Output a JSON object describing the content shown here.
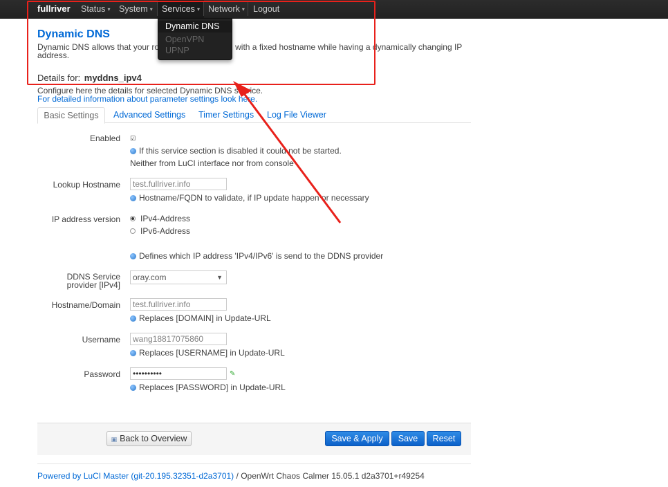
{
  "navbar": {
    "brand": "fullriver",
    "menu": [
      "Status",
      "System",
      "Services",
      "Network",
      "Logout"
    ]
  },
  "dropdown": {
    "items": [
      "Dynamic DNS",
      "OpenVPN",
      "UPNP"
    ]
  },
  "page": {
    "title": "Dynamic DNS",
    "description": "Dynamic DNS allows that your router can be reached with a fixed hostname while having a dynamically changing IP address.",
    "details_label": "Details for:",
    "details_name": "myddns_ipv4",
    "config_text": "Configure here the details for selected Dynamic DNS service.",
    "config_link": "For detailed information about parameter settings look here."
  },
  "tabs": [
    "Basic Settings",
    "Advanced Settings",
    "Timer Settings",
    "Log File Viewer"
  ],
  "form": {
    "enabled": {
      "label": "Enabled",
      "hint1": "If this service section is disabled it could not be started.",
      "hint2": "Neither from LuCI interface nor from console"
    },
    "lookup_host": {
      "label": "Lookup Hostname",
      "value": "test.fullriver.info",
      "hint": "Hostname/FQDN to validate, if IP update happen or necessary"
    },
    "ip_version": {
      "label": "IP address version",
      "options": [
        "IPv4-Address",
        "IPv6-Address"
      ],
      "hint": "Defines which IP address 'IPv4/IPv6' is send to the DDNS provider"
    },
    "provider": {
      "label_line1": "DDNS Service",
      "label_line2": "provider [IPv4]",
      "value": "oray.com"
    },
    "domain": {
      "label": "Hostname/Domain",
      "value": "test.fullriver.info",
      "hint": "Replaces [DOMAIN] in Update-URL"
    },
    "username": {
      "label": "Username",
      "value": "wang18817075860",
      "hint": "Replaces [USERNAME] in Update-URL"
    },
    "password": {
      "label": "Password",
      "value": "••••••••••",
      "hint": "Replaces [PASSWORD] in Update-URL"
    }
  },
  "actions": {
    "back": "Back to Overview",
    "save_apply": "Save & Apply",
    "save": "Save",
    "reset": "Reset"
  },
  "footer": {
    "link": "Powered by LuCI Master (git-20.195.32351-d2a3701)",
    "text": " / OpenWrt Chaos Calmer 15.05.1 d2a3701+r49254"
  },
  "colors": {
    "accent": "#0069d6",
    "navbar": "#222222",
    "annotation": "#e8211b"
  }
}
